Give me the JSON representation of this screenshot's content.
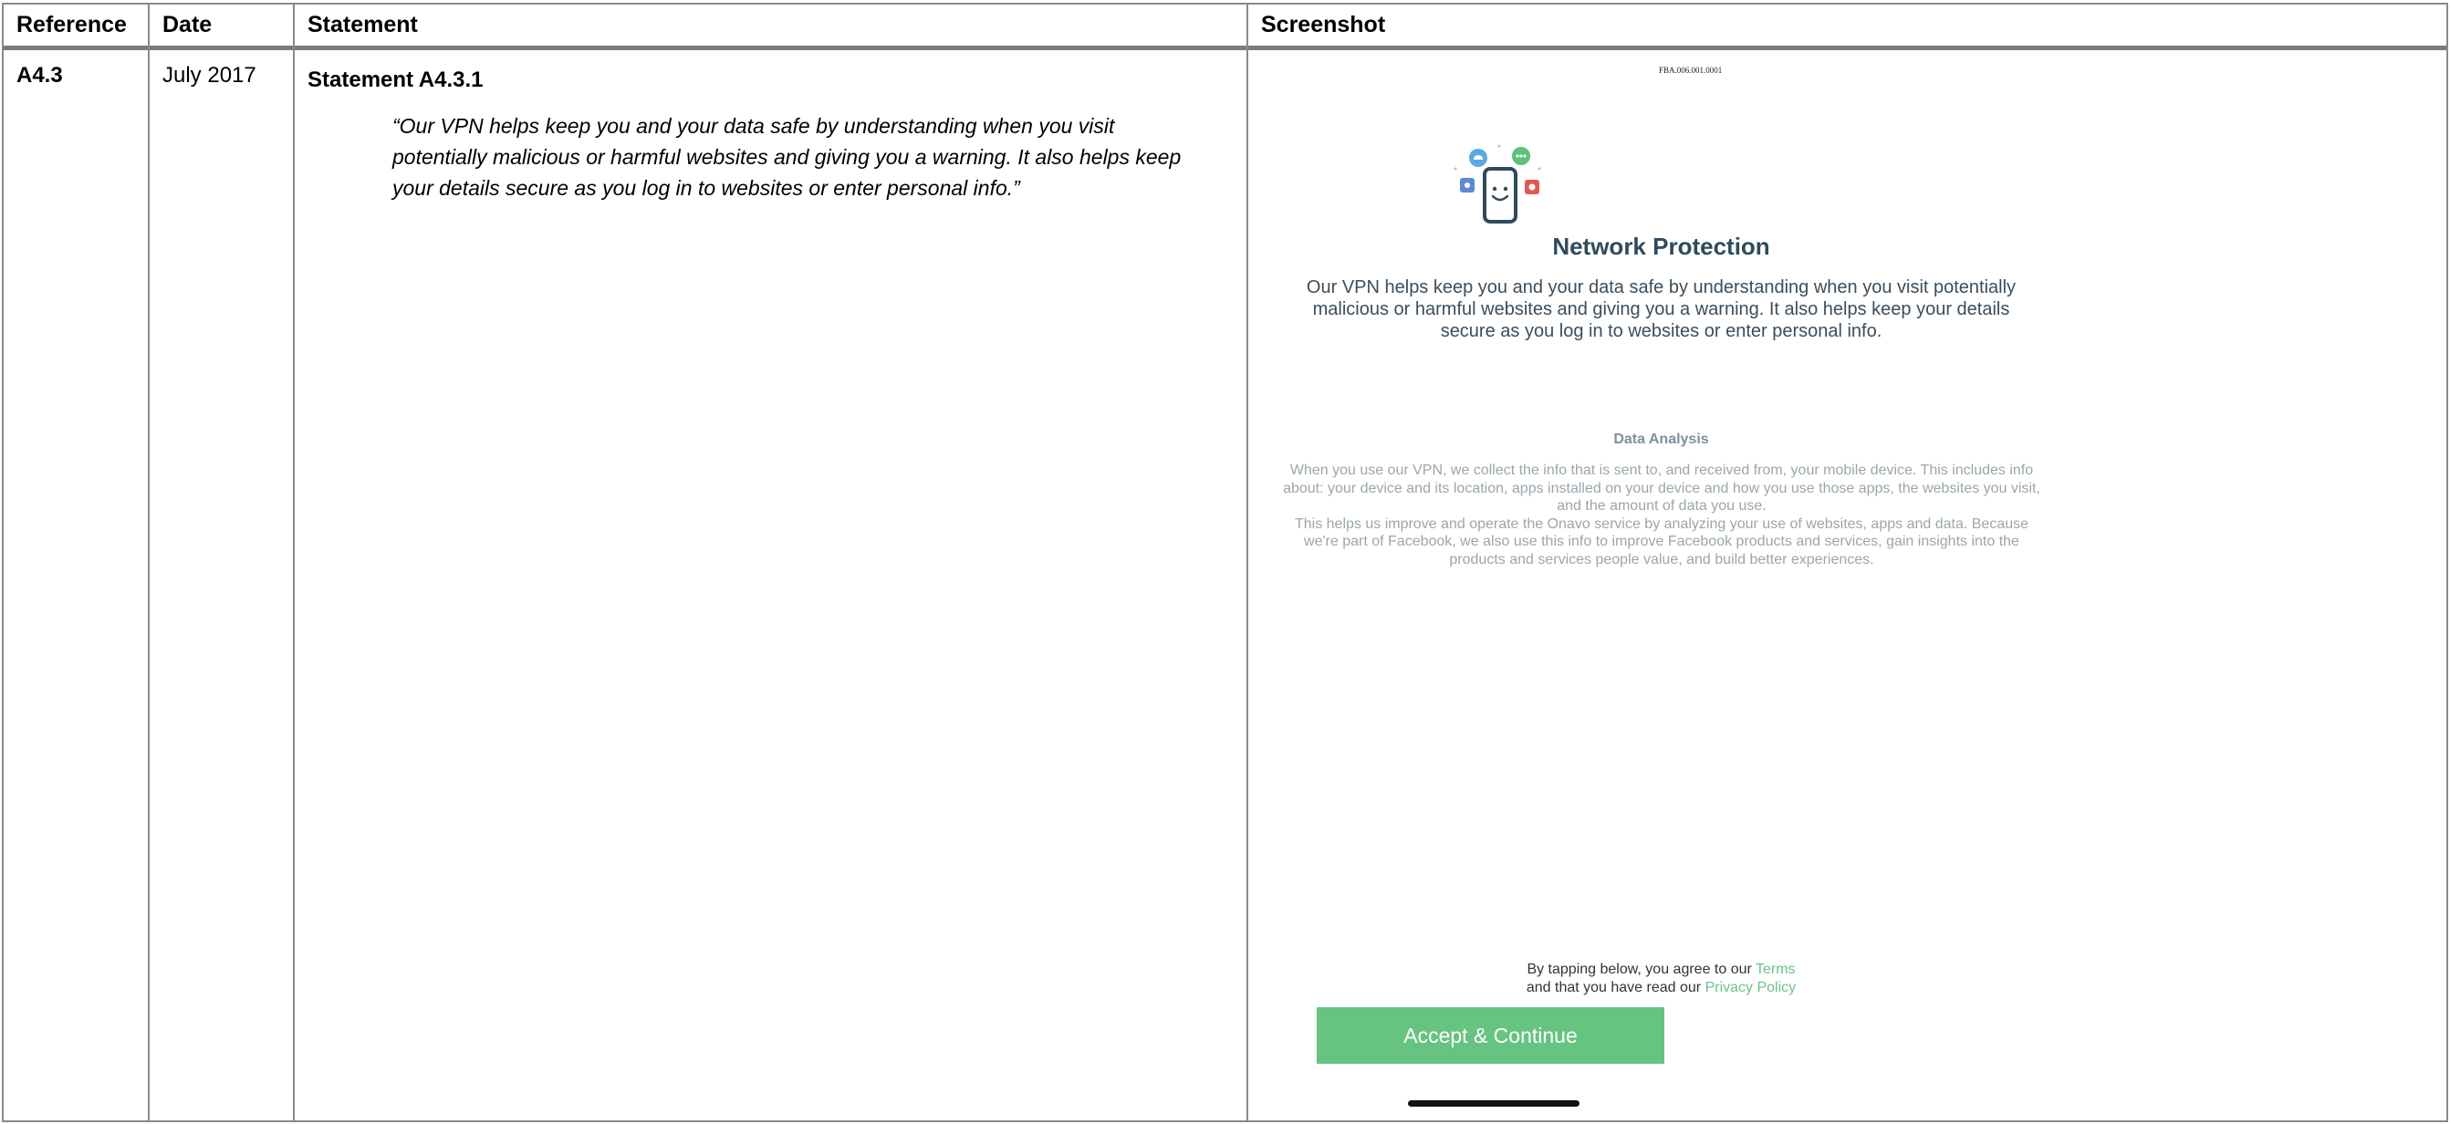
{
  "table": {
    "headers": {
      "reference": "Reference",
      "date": "Date",
      "statement": "Statement",
      "screenshot": "Screenshot"
    },
    "row": {
      "reference": "A4.3",
      "date": "July 2017",
      "statement_title": "Statement A4.3.1",
      "quote": "“Our VPN helps keep you and your data safe by understanding when you visit potentially malicious or harmful websites and giving you a warning. It also helps keep your details secure as you log in to websites or enter personal info.”"
    }
  },
  "screenshot": {
    "bates_label": "FBA.006.001.0001",
    "illustration_icon": "phone-with-app-bubbles-icon",
    "title": "Network Protection",
    "description": "Our VPN helps keep you and your data safe by understanding when you visit potentially malicious or harmful websites and giving you a warning. It also helps keep your details secure as you log in to websites or enter personal info.",
    "data_analysis_title": "Data Analysis",
    "data_analysis_p1": "When you use our VPN, we collect the info that is sent to, and received from, your mobile device. This includes info about: your device and its location, apps installed on your device and how you use those apps, the websites you visit, and the amount of data you use.",
    "data_analysis_p2": "This helps us improve and operate the Onavo service by analyzing your use of websites, apps and data. Because we're part of Facebook, we also use this info to improve Facebook products and services, gain insights into the products and services people value, and build better experiences.",
    "agree_prefix_1": "By tapping below, you agree to our ",
    "terms_link": "Terms",
    "agree_prefix_2": "and that you have read our ",
    "privacy_link": "Privacy Policy",
    "accept_button": "Accept & Continue",
    "colors": {
      "accent_green": "#66c480",
      "title_navy": "#2f4a5c",
      "link_green": "#6cc28a"
    }
  }
}
